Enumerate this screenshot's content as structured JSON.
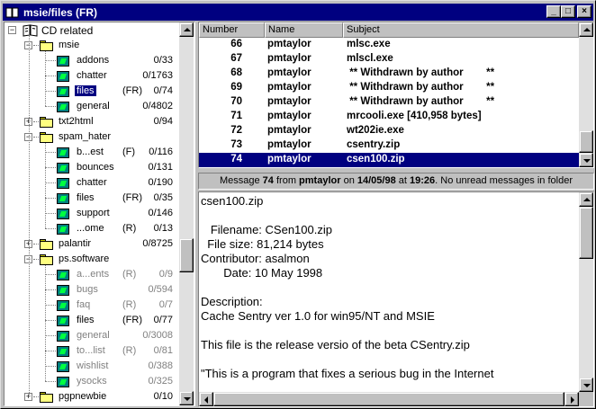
{
  "window": {
    "title": "msie/files (FR)"
  },
  "caption_buttons": {
    "minimize": "_",
    "maximize": "□",
    "close": "×"
  },
  "tree": {
    "root": {
      "label": "CD related",
      "icon": "cd-book-icon"
    },
    "items": [
      {
        "label": "msie",
        "type": "folder",
        "expanded": true,
        "count": ""
      },
      {
        "label": "addons",
        "type": "group",
        "flag": "",
        "count": "0/33"
      },
      {
        "label": "chatter",
        "type": "group",
        "flag": "",
        "count": "0/1763"
      },
      {
        "label": "files",
        "type": "group",
        "flag": "(FR)",
        "count": "0/74",
        "selected": true
      },
      {
        "label": "general",
        "type": "group",
        "flag": "",
        "count": "0/4802"
      },
      {
        "label": "txt2html",
        "type": "folder",
        "expanded": false,
        "count": "0/94"
      },
      {
        "label": "spam_hater",
        "type": "folder",
        "expanded": true,
        "count": ""
      },
      {
        "label": "b...est",
        "type": "group",
        "flag": "(F)",
        "count": "0/116"
      },
      {
        "label": "bounces",
        "type": "group",
        "flag": "",
        "count": "0/131"
      },
      {
        "label": "chatter",
        "type": "group",
        "flag": "",
        "count": "0/190"
      },
      {
        "label": "files",
        "type": "group",
        "flag": "(FR)",
        "count": "0/35"
      },
      {
        "label": "support",
        "type": "group",
        "flag": "",
        "count": "0/146"
      },
      {
        "label": "...ome",
        "type": "group",
        "flag": "(R)",
        "count": "0/13"
      },
      {
        "label": "palantir",
        "type": "folder",
        "expanded": false,
        "count": "0/8725"
      },
      {
        "label": "ps.software",
        "type": "folder",
        "expanded": true,
        "count": ""
      },
      {
        "label": "a...ents",
        "type": "group",
        "flag": "(R)",
        "count": "0/9",
        "dim": true
      },
      {
        "label": "bugs",
        "type": "group",
        "flag": "",
        "count": "0/594",
        "dim": true
      },
      {
        "label": "faq",
        "type": "group",
        "flag": "(R)",
        "count": "0/7",
        "dim": true
      },
      {
        "label": "files",
        "type": "group",
        "flag": "(FR)",
        "count": "0/77"
      },
      {
        "label": "general",
        "type": "group",
        "flag": "",
        "count": "0/3008",
        "dim": true
      },
      {
        "label": "to...list",
        "type": "group",
        "flag": "(R)",
        "count": "0/81",
        "dim": true
      },
      {
        "label": "wishlist",
        "type": "group",
        "flag": "",
        "count": "0/388",
        "dim": true
      },
      {
        "label": "ysocks",
        "type": "group",
        "flag": "",
        "count": "0/325",
        "dim": true
      },
      {
        "label": "pgpnewbie",
        "type": "folder",
        "expanded": false,
        "count": "0/10"
      }
    ]
  },
  "message_list": {
    "columns": [
      "Number",
      "Name",
      "Subject"
    ],
    "rows": [
      {
        "number": "66",
        "name": "pmtaylor",
        "subject": "mlsc.exe"
      },
      {
        "number": "67",
        "name": "pmtaylor",
        "subject": "mlscl.exe"
      },
      {
        "number": "68",
        "name": "pmtaylor",
        "subject": " ** Withdrawn by author        **"
      },
      {
        "number": "69",
        "name": "pmtaylor",
        "subject": " ** Withdrawn by author        **"
      },
      {
        "number": "70",
        "name": "pmtaylor",
        "subject": " ** Withdrawn by author        **"
      },
      {
        "number": "71",
        "name": "pmtaylor",
        "subject": "mrcooli.exe [410,958 bytes]"
      },
      {
        "number": "72",
        "name": "pmtaylor",
        "subject": "wt202ie.exe"
      },
      {
        "number": "73",
        "name": "pmtaylor",
        "subject": "csentry.zip"
      },
      {
        "number": "74",
        "name": "pmtaylor",
        "subject": "csen100.zip",
        "selected": true
      }
    ]
  },
  "status": {
    "t1": "Message ",
    "msgnum": "74",
    "t2": " from ",
    "from": "pmtaylor",
    "t3": " on ",
    "date": "14/05/98",
    "t4": " at ",
    "time": "19:26",
    "t5": ".  No unread messages in folder"
  },
  "message_body": {
    "lines": [
      "csen100.zip",
      "",
      "   Filename: CSen100.zip",
      "  File size: 81,214 bytes",
      "Contributor: asalmon",
      "       Date: 10 May 1998",
      "",
      "Description:",
      "Cache Sentry ver 1.0 for win95/NT and MSIE",
      "",
      "This file is the release versio of the beta CSentry.zip",
      "",
      "\"This is a program that fixes a serious bug in the Internet"
    ]
  },
  "colors": {
    "selection": "#000080",
    "face": "#c0c0c0",
    "folder": "#ffff80",
    "group_icon": "#008080"
  }
}
